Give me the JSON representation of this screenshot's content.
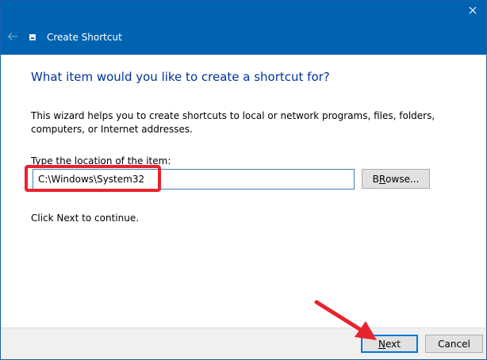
{
  "window": {
    "title": "Create Shortcut"
  },
  "wizard": {
    "heading": "What item would you like to create a shortcut for?",
    "description": "This wizard helps you to create shortcuts to local or network programs, files, folders, computers, or Internet addresses.",
    "location_label_accel": "T",
    "location_label_rest": "ype the location of the item:",
    "location_value": "C:\\Windows\\System32",
    "browse_accel": "R",
    "browse_pre": "B",
    "browse_rest": "owse...",
    "continue_text": "Click Next to continue."
  },
  "footer": {
    "next_accel": "N",
    "next_rest": "ext",
    "cancel_label": "Cancel"
  },
  "colors": {
    "titlebar": "#0063b1",
    "heading": "#003399",
    "highlight": "#e8232e",
    "default_button_border": "#0078d7"
  },
  "icons": {
    "close": "close-icon",
    "back": "back-arrow-icon",
    "app": "shortcut-icon"
  }
}
